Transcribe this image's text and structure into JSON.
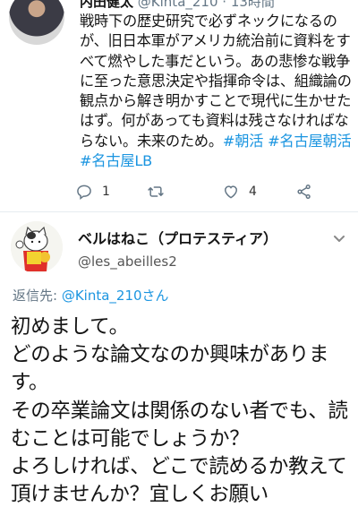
{
  "tweet1": {
    "name_partial": "内田健太",
    "handle_partial": "@Kinta_210 · 13時間",
    "body": "戦時下の歴史研究で必ずネックになるのが、旧日本軍がアメリカ統治前に資料をすべて燃やした事だという。あの悲惨な戦争に至った意思決定や指揮命令は、組織論の観点から解き明かすことで現代に生かせたはず。何があっても資料は残さなければならない。未来のため。",
    "hashtags": [
      "#朝活",
      "#名古屋朝活",
      "#名古屋LB"
    ],
    "actions": {
      "reply_icon": "reply-icon",
      "reply_count": "1",
      "retweet_icon": "retweet-icon",
      "like_icon": "heart-icon",
      "like_count": "4",
      "share_icon": "share-icon"
    }
  },
  "tweet2": {
    "display_name": "ベルはねこ（プロテスティア）",
    "handle": "@les_abeilles2",
    "replying_prefix": "返信先: ",
    "replying_to": "@Kinta_210さん",
    "body": "初めまして。\nどのような論文なのか興味がありま す。\nその卒業論文は関係のない者でも、読むことは可能でしょうか？\nよろしければ、どこで読めるか教えて頂けませんか？宜しくお願い",
    "menu_icon": "chevron-down-icon"
  }
}
